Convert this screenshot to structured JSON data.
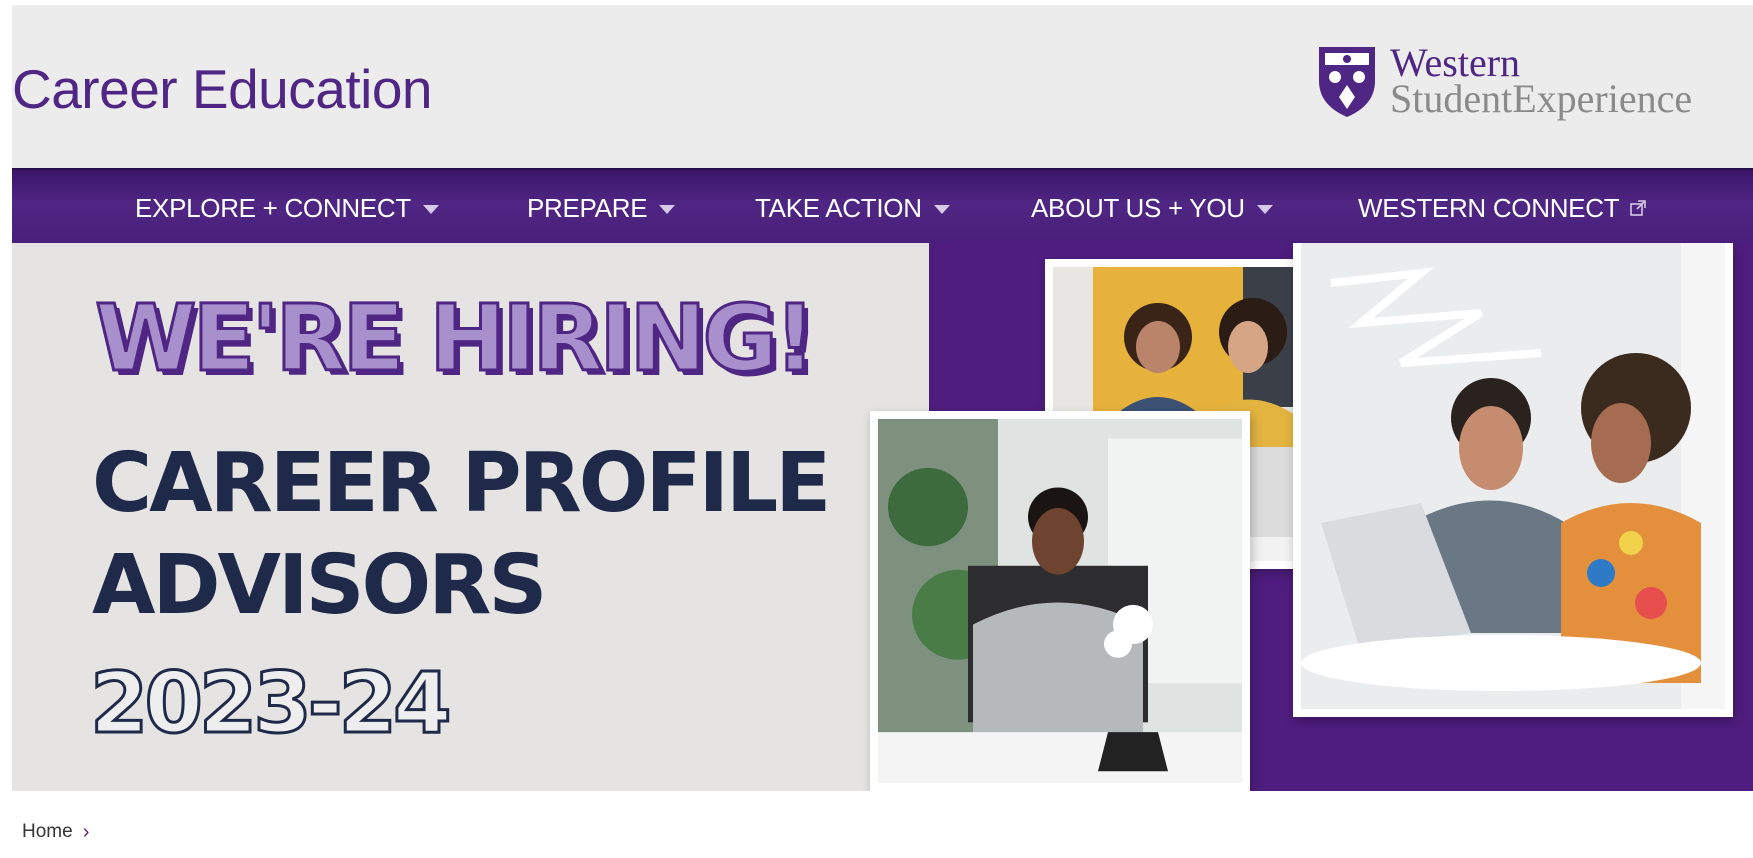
{
  "header": {
    "site_title": "Career Education",
    "logo": {
      "line1": "Western",
      "line2": "StudentExperience",
      "icon": "western-crest-icon"
    }
  },
  "nav": {
    "items": [
      {
        "label": "EXPLORE + CONNECT",
        "icon": "caret-down-icon"
      },
      {
        "label": "PREPARE",
        "icon": "caret-down-icon"
      },
      {
        "label": "TAKE ACTION",
        "icon": "caret-down-icon"
      },
      {
        "label": "ABOUT US + YOU",
        "icon": "caret-down-icon"
      },
      {
        "label": "WESTERN CONNECT",
        "icon": "external-link-icon"
      }
    ]
  },
  "hero": {
    "headline": "WE'RE HIRING!",
    "line1": "CAREER PROFILE",
    "line2": "ADVISORS",
    "year": "2023-24"
  },
  "breadcrumb": {
    "items": [
      {
        "label": "Home"
      }
    ],
    "separator": "›"
  },
  "colors": {
    "brand_purple": "#4f2683",
    "banner_purple": "#4e1d7e",
    "navy": "#1f2a4a",
    "hiring_fill": "#a890cc"
  }
}
